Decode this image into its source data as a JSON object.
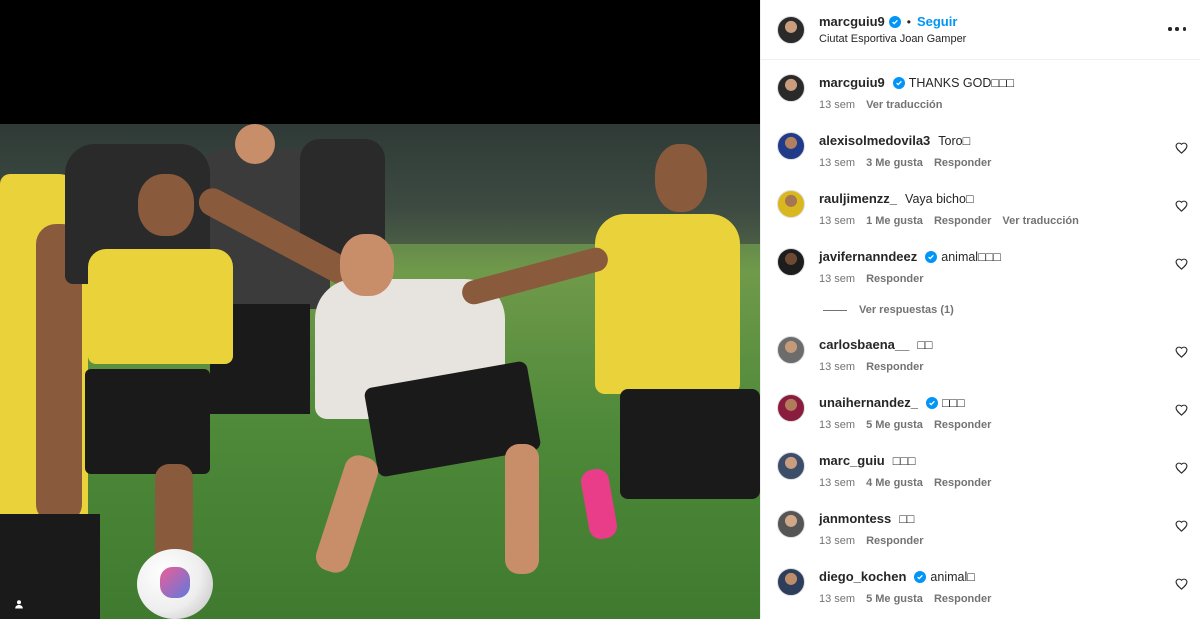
{
  "post": {
    "author": "marcguiu9",
    "follow_label": "Seguir",
    "separator": "•",
    "location": "Ciutat Esportiva Joan Gamper",
    "caption_text": "THANKS GOD□□□",
    "caption_time": "13 sem",
    "caption_translate": "Ver traducción"
  },
  "comments": [
    {
      "username": "alexisolmedovila3",
      "verified": false,
      "text": "Toro□",
      "time": "13 sem",
      "likes": "3 Me gusta",
      "reply": "Responder",
      "translate": ""
    },
    {
      "username": "rauljimenzz_",
      "verified": false,
      "text": "Vaya bicho□",
      "time": "13 sem",
      "likes": "1 Me gusta",
      "reply": "Responder",
      "translate": "Ver traducción"
    },
    {
      "username": "javifernanndeez",
      "verified": true,
      "text": "animal□□□",
      "time": "13 sem",
      "likes": "",
      "reply": "Responder",
      "translate": ""
    },
    {
      "username": "carlosbaena__",
      "verified": false,
      "text": "□□",
      "time": "13 sem",
      "likes": "",
      "reply": "Responder",
      "translate": ""
    },
    {
      "username": "unaihernandez_",
      "verified": true,
      "text": "□□□",
      "time": "13 sem",
      "likes": "5 Me gusta",
      "reply": "Responder",
      "translate": ""
    },
    {
      "username": "marc_guiu",
      "verified": false,
      "text": "□□□",
      "time": "13 sem",
      "likes": "4 Me gusta",
      "reply": "Responder",
      "translate": ""
    },
    {
      "username": "janmontess",
      "verified": false,
      "text": "□□",
      "time": "13 sem",
      "likes": "",
      "reply": "Responder",
      "translate": ""
    },
    {
      "username": "diego_kochen",
      "verified": true,
      "text": "animal□",
      "time": "13 sem",
      "likes": "5 Me gusta",
      "reply": "Responder",
      "translate": ""
    }
  ],
  "view_replies_label": "Ver respuestas (1)",
  "colors": {
    "accent": "#0095f6",
    "muted": "#737373",
    "text": "#262626"
  },
  "icons": [
    "verified-badge-icon",
    "more-options-icon",
    "heart-icon",
    "user-tag-icon"
  ]
}
